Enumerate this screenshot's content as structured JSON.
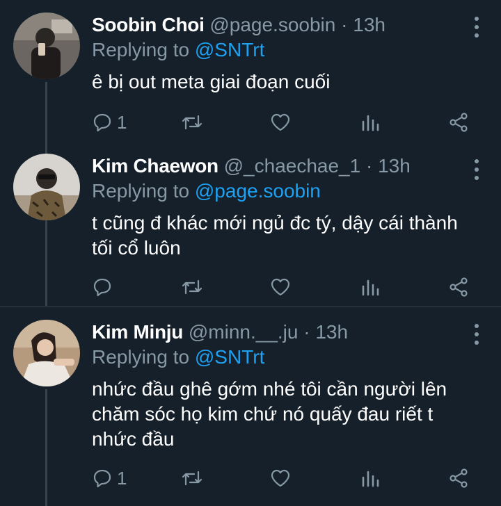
{
  "tweets": [
    {
      "name": "Soobin Choi",
      "handle": "@page.soobin",
      "time": "13h",
      "replying_prefix": "Replying to",
      "replying_to": "@SNTrt",
      "text_lines": [
        "ê bị out meta giai đoạn cuối"
      ],
      "reply_count": "1"
    },
    {
      "name": "Kim Chaewon",
      "handle": "@_chaechae_1",
      "time": "13h",
      "replying_prefix": "Replying to",
      "replying_to": "@page.soobin",
      "text_lines": [
        "t cũng đ khác mới ngủ đc tý, dậy cái thành",
        "tối cổ luôn"
      ],
      "reply_count": ""
    },
    {
      "name": "Kim Minju",
      "handle": "@minn.__.ju",
      "time": "13h",
      "replying_prefix": "Replying to",
      "replying_to": "@SNTrt",
      "text_lines": [
        "nhức đầu ghê gớm nhé tôi cần người lên",
        "chăm sóc họ kim chứ nó quấy đau riết t",
        "nhức đầu"
      ],
      "reply_count": "1"
    }
  ],
  "separator": "·",
  "icons": {
    "reply": "reply-icon",
    "retweet": "retweet-icon",
    "like": "heart-icon",
    "analytics": "analytics-icon",
    "share": "share-icon",
    "more": "more-vertical-icon"
  },
  "colors": {
    "background": "#15202b",
    "secondary_text": "#8899a6",
    "mention": "#1da1f2",
    "divider": "#38444d"
  }
}
